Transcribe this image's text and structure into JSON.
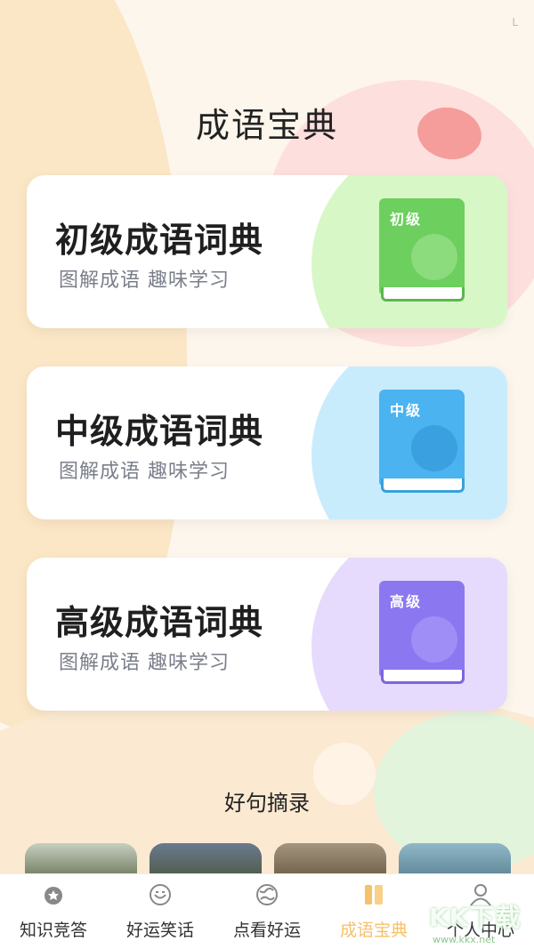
{
  "status_indicator": "L",
  "page_title": "成语宝典",
  "cards": [
    {
      "title": "初级成语词典",
      "subtitle": "图解成语 趣味学习",
      "book_label": "初级",
      "icon": "compass-icon",
      "color": "#6ccf5e",
      "wash": "#d8f7c6"
    },
    {
      "title": "中级成语词典",
      "subtitle": "图解成语 趣味学习",
      "book_label": "中级",
      "icon": "pen-nib-icon",
      "color": "#4bb3f0",
      "wash": "#c9ecfd"
    },
    {
      "title": "高级成语词典",
      "subtitle": "图解成语 趣味学习",
      "book_label": "高级",
      "icon": "notebook-icon",
      "color": "#8b78f0",
      "wash": "#e6dbfc"
    }
  ],
  "section_title": "好句摘录",
  "tabs": [
    {
      "label": "知识竞答",
      "icon": "medal-icon"
    },
    {
      "label": "好运笑话",
      "icon": "smile-icon"
    },
    {
      "label": "点看好运",
      "icon": "globe-icon"
    },
    {
      "label": "成语宝典",
      "icon": "books-icon",
      "active": true
    },
    {
      "label": "个人中心",
      "icon": "person-icon"
    }
  ],
  "active_color": "#f5c26a",
  "watermark": "KK下载",
  "watermark_url": "www.kkx.net"
}
